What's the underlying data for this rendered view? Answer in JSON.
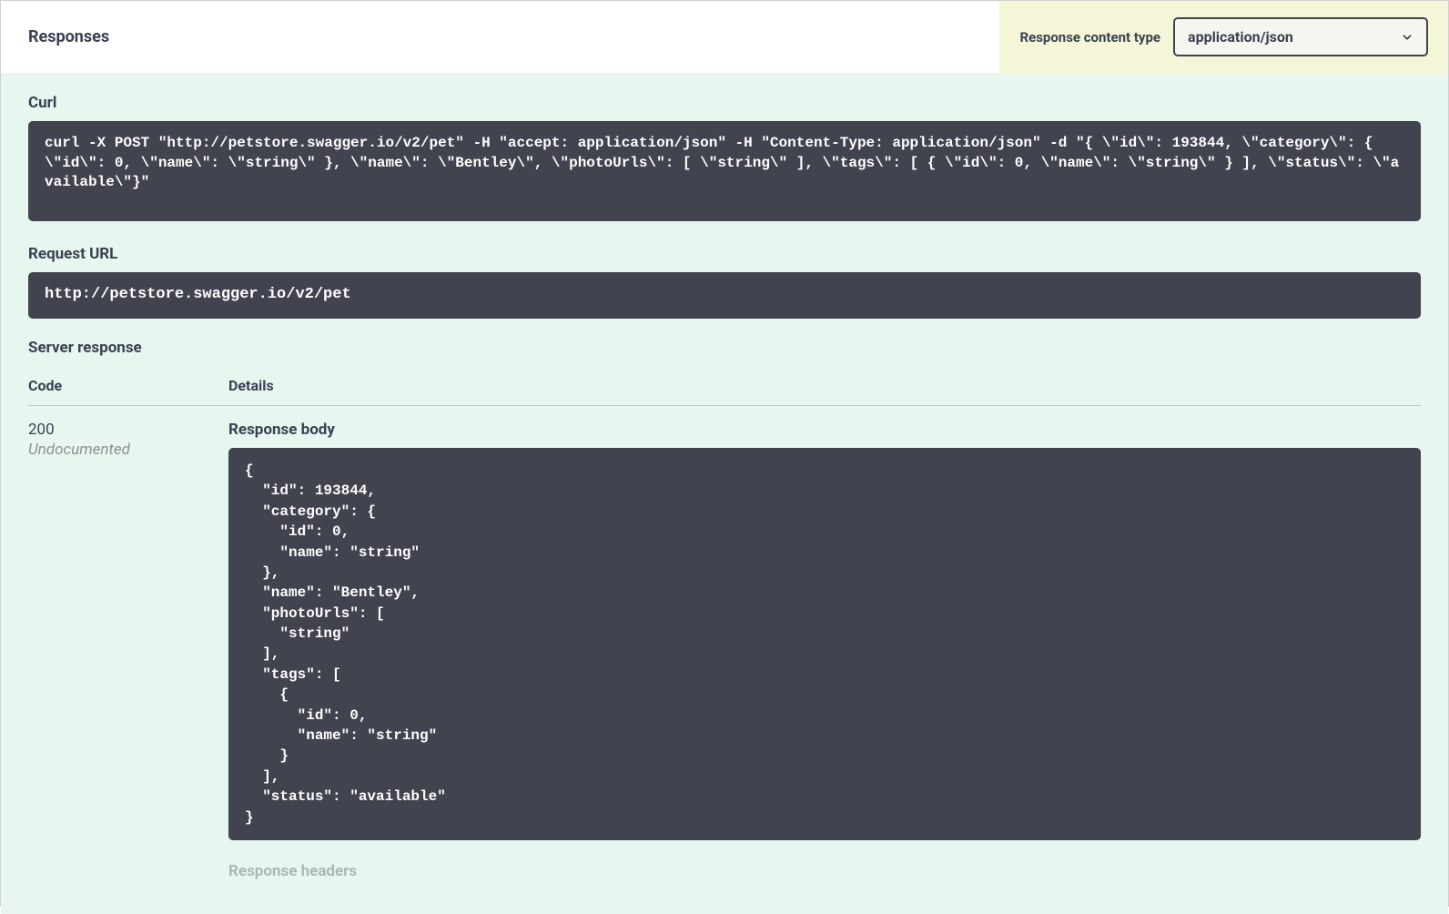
{
  "header": {
    "title": "Responses",
    "content_type_label": "Response content type",
    "content_type_value": "application/json"
  },
  "sections": {
    "curl_label": "Curl",
    "curl_text": "curl -X POST \"http://petstore.swagger.io/v2/pet\" -H \"accept: application/json\" -H \"Content-Type: application/json\" -d \"{ \\\"id\\\": 193844, \\\"category\\\": { \\\"id\\\": 0, \\\"name\\\": \\\"string\\\" }, \\\"name\\\": \\\"Bentley\\\", \\\"photoUrls\\\": [ \\\"string\\\" ], \\\"tags\\\": [ { \\\"id\\\": 0, \\\"name\\\": \\\"string\\\" } ], \\\"status\\\": \\\"available\\\"}\"",
    "request_url_label": "Request URL",
    "request_url": "http://petstore.swagger.io/v2/pet",
    "server_response_label": "Server response",
    "code_header": "Code",
    "details_header": "Details",
    "response_code": "200",
    "undocumented": "Undocumented",
    "response_body_label": "Response body",
    "response_body": "{\n  \"id\": 193844,\n  \"category\": {\n    \"id\": 0,\n    \"name\": \"string\"\n  },\n  \"name\": \"Bentley\",\n  \"photoUrls\": [\n    \"string\"\n  ],\n  \"tags\": [\n    {\n      \"id\": 0,\n      \"name\": \"string\"\n    }\n  ],\n  \"status\": \"available\"\n}",
    "response_headers_label": "Response headers"
  }
}
